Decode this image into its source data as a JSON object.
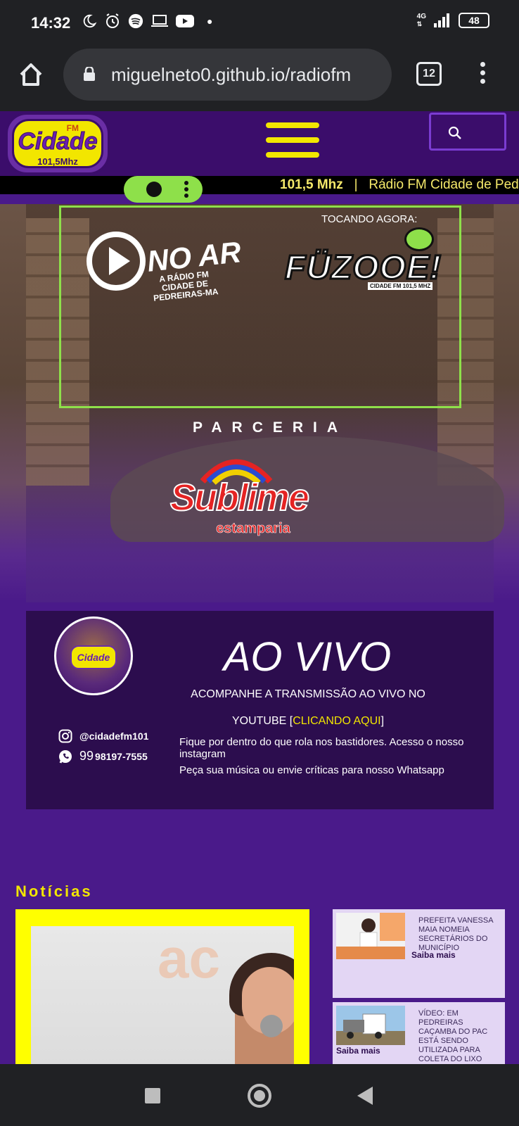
{
  "status_bar": {
    "time": "14:32",
    "network": "4G",
    "battery": "48",
    "icons": [
      "moon-icon",
      "alarm-icon",
      "spotify-icon",
      "laptop-icon",
      "youtube-icon",
      "dot-icon"
    ]
  },
  "browser": {
    "url": "miguelneto0.github.io/radiofm",
    "tab_count": "12"
  },
  "header": {
    "logo_fm": "FM",
    "logo_name": "Cidade",
    "logo_freq": "101,5Mhz"
  },
  "ticker": {
    "frequency": "101,5 Mhz",
    "separator": "|",
    "text": "Rádio FM Cidade de Pedreiras"
  },
  "hero": {
    "now_playing_label": "TOCANDO AGORA:",
    "on_air_text": "NO AR",
    "on_air_sub": "A RÁDIO FM CIDADE DE PEDREIRAS-MA",
    "program_name": "FÜZOOE!",
    "program_sub": "CIDADE FM 101,5 MHZ",
    "partner_label": "PARCERIA",
    "partner_name": "Sublime",
    "partner_sub": "estamparia"
  },
  "live": {
    "title": "AO VIVO",
    "line1": "ACOMPANHE A TRANSMISSÃO AO VIVO NO",
    "line2_prefix": "YOUTUBE [",
    "line2_link": "CLICANDO AQUI",
    "line2_suffix": "]",
    "instagram": "@cidadefm101",
    "whatsapp_prefix": "99",
    "whatsapp": "98197-7555",
    "desc1": "Fique por dentro do que rola nos bastidores. Acesso o nosso instagram",
    "desc2": "Peça sua música ou envie críticas para nosso Whatsapp"
  },
  "news": {
    "title": "Notícias",
    "items": [
      {
        "headline": "PREFEITA VANESSA MAIA NOMEIA SECRETÁRIOS DO MUNICÍPIO",
        "more": "Saiba mais"
      },
      {
        "headline": "VÍDEO: EM PEDREIRAS CAÇAMBA DO PAC ESTÁ SENDO UTILIZADA PARA COLETA DO LIXO",
        "more": "Saiba mais"
      }
    ]
  },
  "colors": {
    "accent_yellow": "#f2e600",
    "brand_purple": "#4a1a8a",
    "header_purple": "#3b0d6b",
    "card_purple": "#2c0d4e",
    "lime": "#8ee04a",
    "sublime_red": "#e52323"
  }
}
